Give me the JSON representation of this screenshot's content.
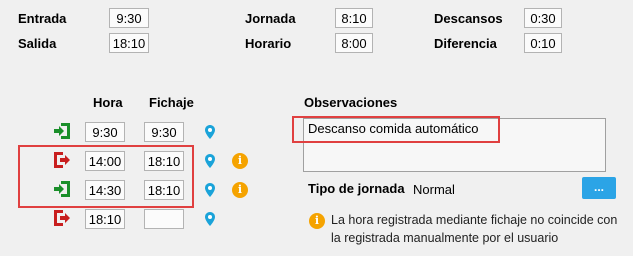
{
  "summary": {
    "entrada": {
      "label": "Entrada",
      "value": "9:30"
    },
    "salida": {
      "label": "Salida",
      "value": "18:10"
    },
    "jornada": {
      "label": "Jornada",
      "value": "8:10"
    },
    "horario": {
      "label": "Horario",
      "value": "8:00"
    },
    "descansos": {
      "label": "Descansos",
      "value": "0:30"
    },
    "diferencia": {
      "label": "Diferencia",
      "value": "0:10"
    }
  },
  "table": {
    "headers": {
      "hora": "Hora",
      "fichaje": "Fichaje"
    },
    "rows": [
      {
        "type": "entry",
        "hora": "9:30",
        "fichaje": "9:30",
        "warning": false
      },
      {
        "type": "exit",
        "hora": "14:00",
        "fichaje": "18:10",
        "warning": true
      },
      {
        "type": "entry",
        "hora": "14:30",
        "fichaje": "18:10",
        "warning": true
      },
      {
        "type": "exit",
        "hora": "18:10",
        "fichaje": "",
        "warning": false
      }
    ]
  },
  "observaciones": {
    "label": "Observaciones",
    "value": "Descanso comida automático"
  },
  "tipo_jornada": {
    "label": "Tipo de jornada",
    "value": "Normal",
    "button_label": "..."
  },
  "warning_message": "La hora registrada mediante fichaje no coincide con la registrada manualmente por el usuario",
  "colors": {
    "entry_green": "#1a8f2a",
    "exit_red": "#c81e1e",
    "pin_blue": "#1aa3d9",
    "warning_orange": "#f5a300",
    "button_blue": "#2ba4e6",
    "highlight_red": "#e04040"
  },
  "icons": {
    "entry": "login-arrow-icon",
    "exit": "logout-arrow-icon",
    "location": "location-pin-icon",
    "info": "info-icon"
  }
}
